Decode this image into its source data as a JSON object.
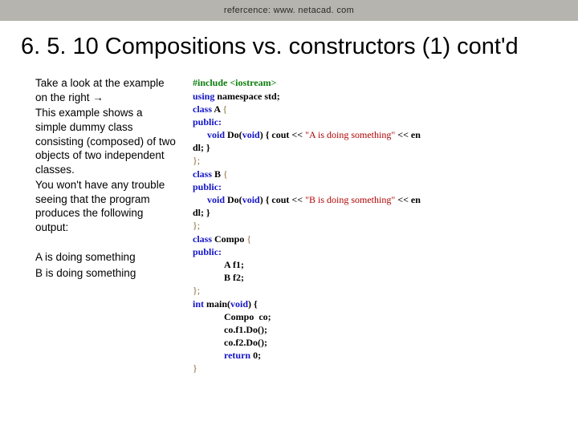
{
  "topbar": {
    "reference": "refercence: www. netacad. com"
  },
  "heading": "6. 5. 10 Compositions vs. constructors (1) cont'd",
  "left": {
    "p1": "Take a look at the example on the right →",
    "p2": "This example shows a simple dummy class consisting (composed) of two objects of two independent classes.",
    "p3": "You won't have any trouble seeing that the program produces the following output:",
    "out1": "A is doing something",
    "out2": "B is doing something"
  },
  "code": {
    "kw_include": "#include <iostream>",
    "kw_using": "using",
    "ns": " namespace ",
    "std": "std;",
    "kw_class": "class",
    "A": " A ",
    "B": " B ",
    "Compo": " Compo ",
    "lbrace": "{",
    "rbrace": "}",
    "rbrace_semi": "};",
    "public": "public:",
    "indent1": "      ",
    "indent2": "             ",
    "kw_void": "void",
    "Do": " Do(",
    "void_param": "void",
    "close_paren_sp": ") ",
    "cout": "{ cout << ",
    "strA": "\"A is doing something\"",
    "strB": "\"B is doing something\"",
    "endl_tail": " << en",
    "dl_line": "dl; }",
    "A_f1": "A f1;",
    "B_f2": "B f2;",
    "kw_int": "int",
    "main": " main(",
    "main_body_open": ") {",
    "compo_decl": "Compo  co;",
    "call1": "co.f1.Do();",
    "call2": "co.f2.Do();",
    "kw_return": "return",
    "zero": " 0;"
  }
}
